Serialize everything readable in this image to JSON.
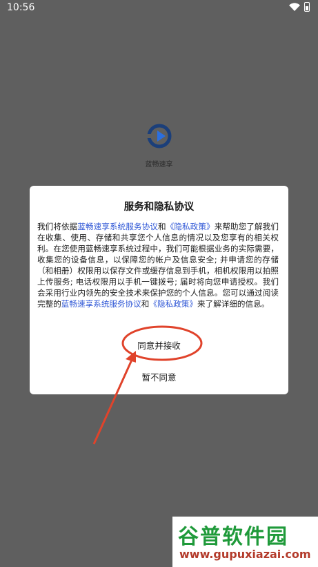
{
  "status_bar": {
    "time": "10:56"
  },
  "app": {
    "name": "蓝畅速享",
    "logo_color": "#1b3f7a",
    "logo_accent": "#2b6fe0"
  },
  "dialog": {
    "title": "服务和隐私协议",
    "body": {
      "p1": "我们将依据",
      "link_service": "蓝畅速享系统服务协议",
      "p2": "和",
      "link_privacy": "《隐私政策》",
      "p3": "来帮助您了解我们在收集、使用、存储和共享您个人信息的情况以及您享有的相关权利。在您使用蓝畅速享系统过程中，我们可能根据业务的实际需要，收集您的设备信息，以保障您的帐户及信息安全; 并申请您的存储（和相册）权限用以保存文件或缓存信息到手机，相机权限用以拍照上传服务; 电话权限用以手机一键拨号; 届时将向您申请授权。我们会采用行业内领先的安全技术来保护您的个人信息。您可以通过阅读完整的",
      "link_service2": "蓝畅速享系统服务协议",
      "p4": "和",
      "link_privacy2": "《隐私政策》",
      "p5": "来了解详细的信息。"
    },
    "agree_label": "同意并接收",
    "disagree_label": "暂不同意"
  },
  "watermark": {
    "top": "谷普软件园",
    "bottom": "www.gupuxiazai.com"
  },
  "colors": {
    "link": "#2f57d6",
    "annotation": "#e0432b",
    "overlay": "#5f5f5f"
  }
}
